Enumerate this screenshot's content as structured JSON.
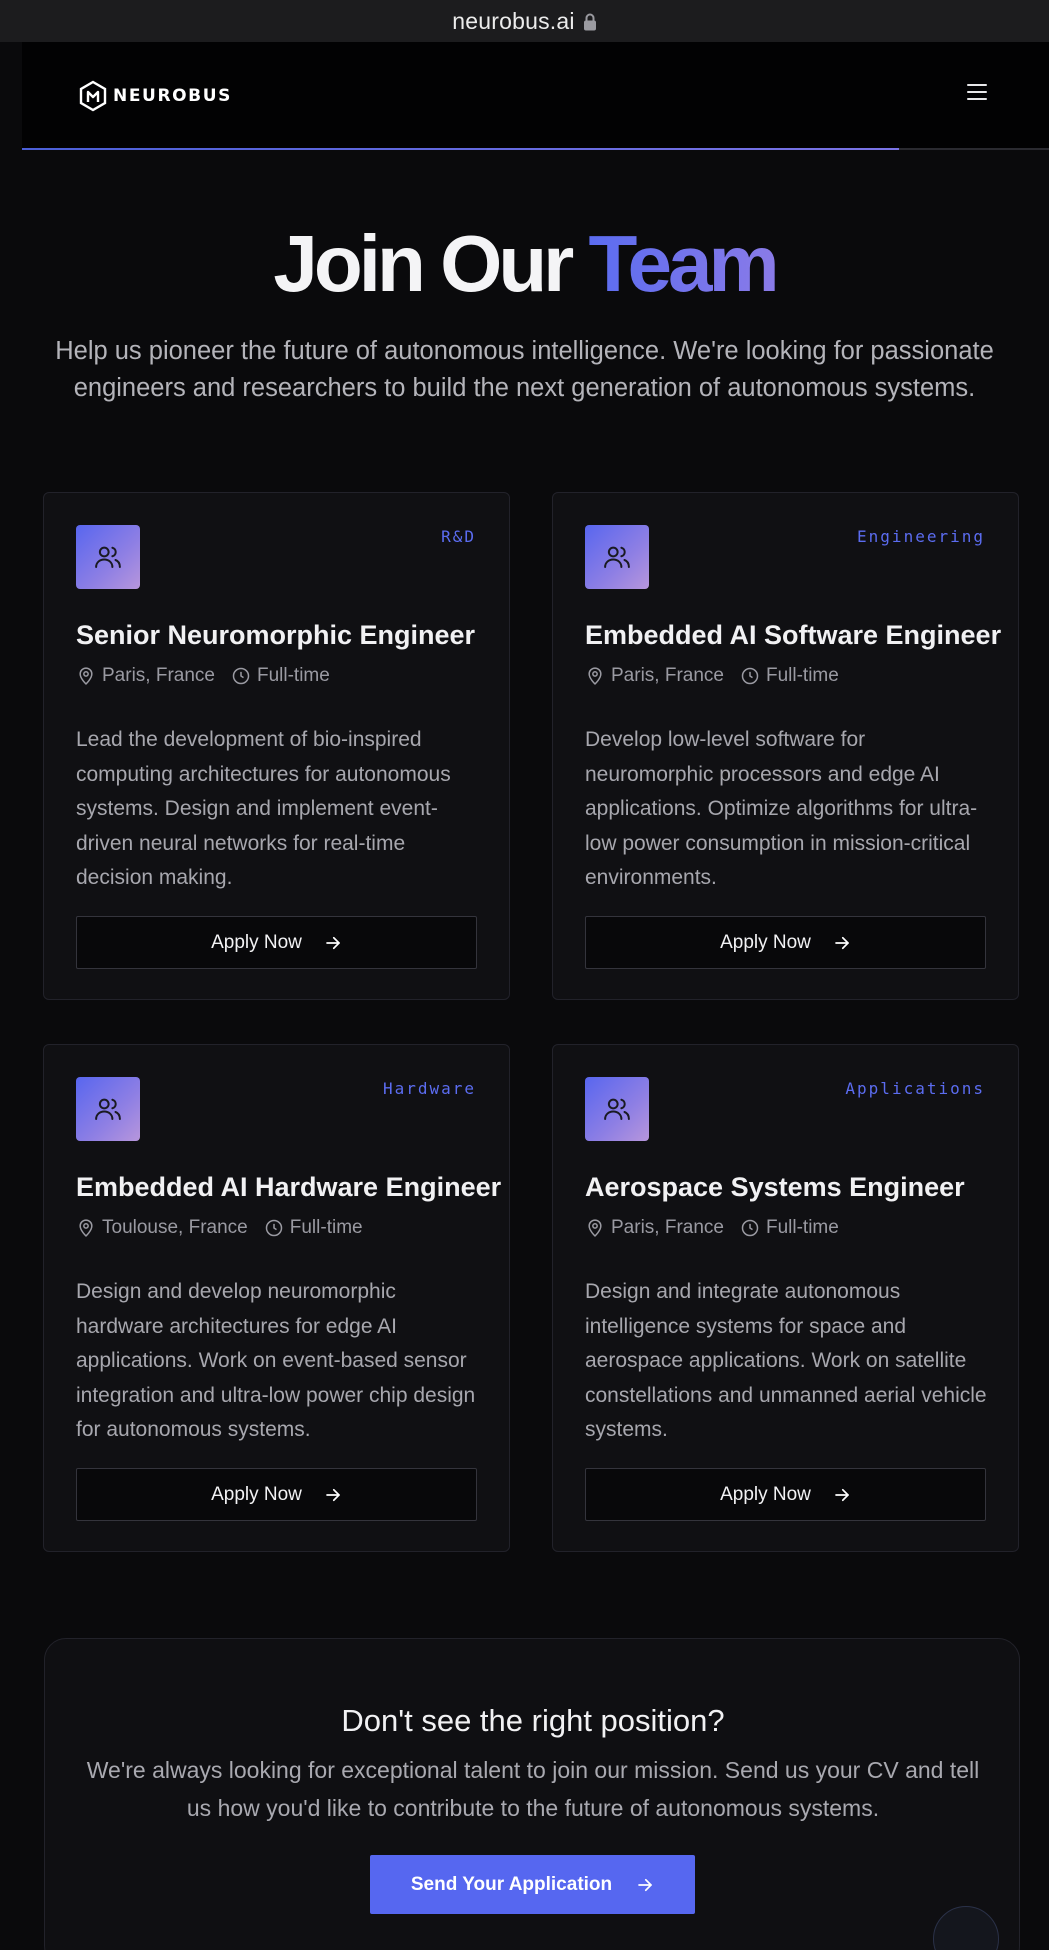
{
  "browser": {
    "url": "neurobus.ai"
  },
  "nav": {
    "brand": "NEUROBUS"
  },
  "hero": {
    "title_main": "Join Our",
    "title_accent": "Team",
    "subtitle": "Help us pioneer the future of autonomous intelligence. We're looking for passionate engineers and researchers to build the next generation of autonomous systems."
  },
  "jobs": [
    {
      "tag": "R&D",
      "title": "Senior Neuromorphic Engineer",
      "location": "Paris, France",
      "type": "Full-time",
      "description": "Lead the development of bio-inspired computing architectures for autonomous systems. Design and implement event-driven neural networks for real-time decision making.",
      "apply_label": "Apply Now"
    },
    {
      "tag": "Engineering",
      "title": "Embedded AI Software Engineer",
      "location": "Paris, France",
      "type": "Full-time",
      "description": "Develop low-level software for neuromorphic processors and edge AI applications. Optimize algorithms for ultra-low power consumption in mission-critical environments.",
      "apply_label": "Apply Now"
    },
    {
      "tag": "Hardware",
      "title": "Embedded AI Hardware Engineer",
      "location": "Toulouse, France",
      "type": "Full-time",
      "description": "Design and develop neuromorphic hardware architectures for edge AI applications. Work on event-based sensor integration and ultra-low power chip design for autonomous systems.",
      "apply_label": "Apply Now"
    },
    {
      "tag": "Applications",
      "title": "Aerospace Systems Engineer",
      "location": "Paris, France",
      "type": "Full-time",
      "description": "Design and integrate autonomous intelligence systems for space and aerospace applications. Work on satellite constellations and unmanned aerial vehicle systems.",
      "apply_label": "Apply Now"
    }
  ],
  "cta": {
    "title": "Don't see the right position?",
    "text": "We're always looking for exceptional talent to join our mission. Send us your CV and tell us how you'd like to contribute to the future of autonomous systems.",
    "button_label": "Send Your Application"
  },
  "icons": {
    "job": "users-icon",
    "location": "map-pin-icon",
    "type": "clock-icon",
    "apply": "arrow-right-icon",
    "menu": "hamburger-menu-icon",
    "url": "lock-icon"
  },
  "colors": {
    "accent": "#5b6cf0",
    "background": "#0a0a0c",
    "card": "#101013"
  }
}
